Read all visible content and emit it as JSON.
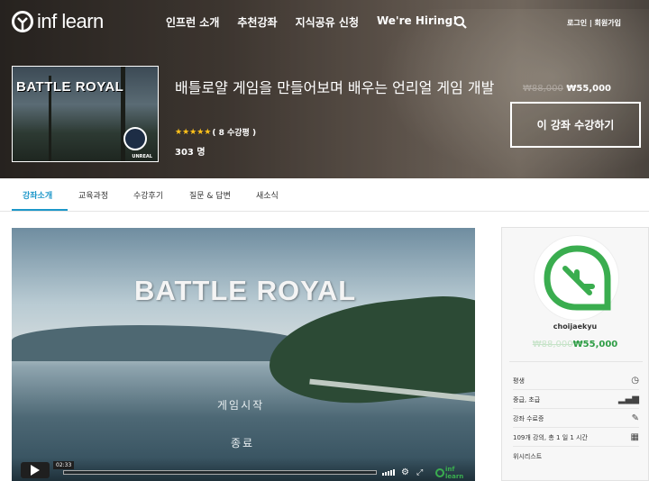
{
  "nav": {
    "logo_text": "inf learn",
    "menu": [
      "인프런 소개",
      "추천강좌",
      "지식공유 신청",
      "We're Hiring!"
    ],
    "auth": "로그인 | 회원가입"
  },
  "course": {
    "thumbnail_title": "BATTLE ROYAL",
    "thumbnail_badge": "UNREAL",
    "title": "배틀로얄 게임을 만들어보며 배우는 언리얼 게임 개발",
    "rating_stars": 5,
    "review_text": "( 8 수강평 )",
    "students": "303 명",
    "original_price": "₩88,000",
    "sale_price": "₩55,000",
    "enroll_label": "이 강좌 수강하기"
  },
  "tabs": [
    "강좌소개",
    "교육과정",
    "수강후기",
    "질문 & 답변",
    "새소식"
  ],
  "video": {
    "title": "BATTLE ROYAL",
    "menu_start": "게임시작",
    "menu_end": "종료",
    "timecode": "02:33",
    "watermark": "inf learn"
  },
  "instructor": {
    "name": "choijaekyu",
    "original_price": "₩88,000",
    "sale_price": "₩55,000"
  },
  "info_rows": [
    {
      "label": "평생",
      "icon": "clock-icon"
    },
    {
      "label": "중급, 초급",
      "icon": "bar-chart-icon"
    },
    {
      "label": "강좌 수료증",
      "icon": "certificate-icon"
    },
    {
      "label": "109개 강의, 총 1 일 1 시간",
      "icon": "grid-icon"
    },
    {
      "label": "위시리스트",
      "icon": "heart-icon"
    }
  ],
  "colors": {
    "accent": "#1d97c9",
    "brand_green": "#2e9d45",
    "star": "#ffc21a"
  }
}
